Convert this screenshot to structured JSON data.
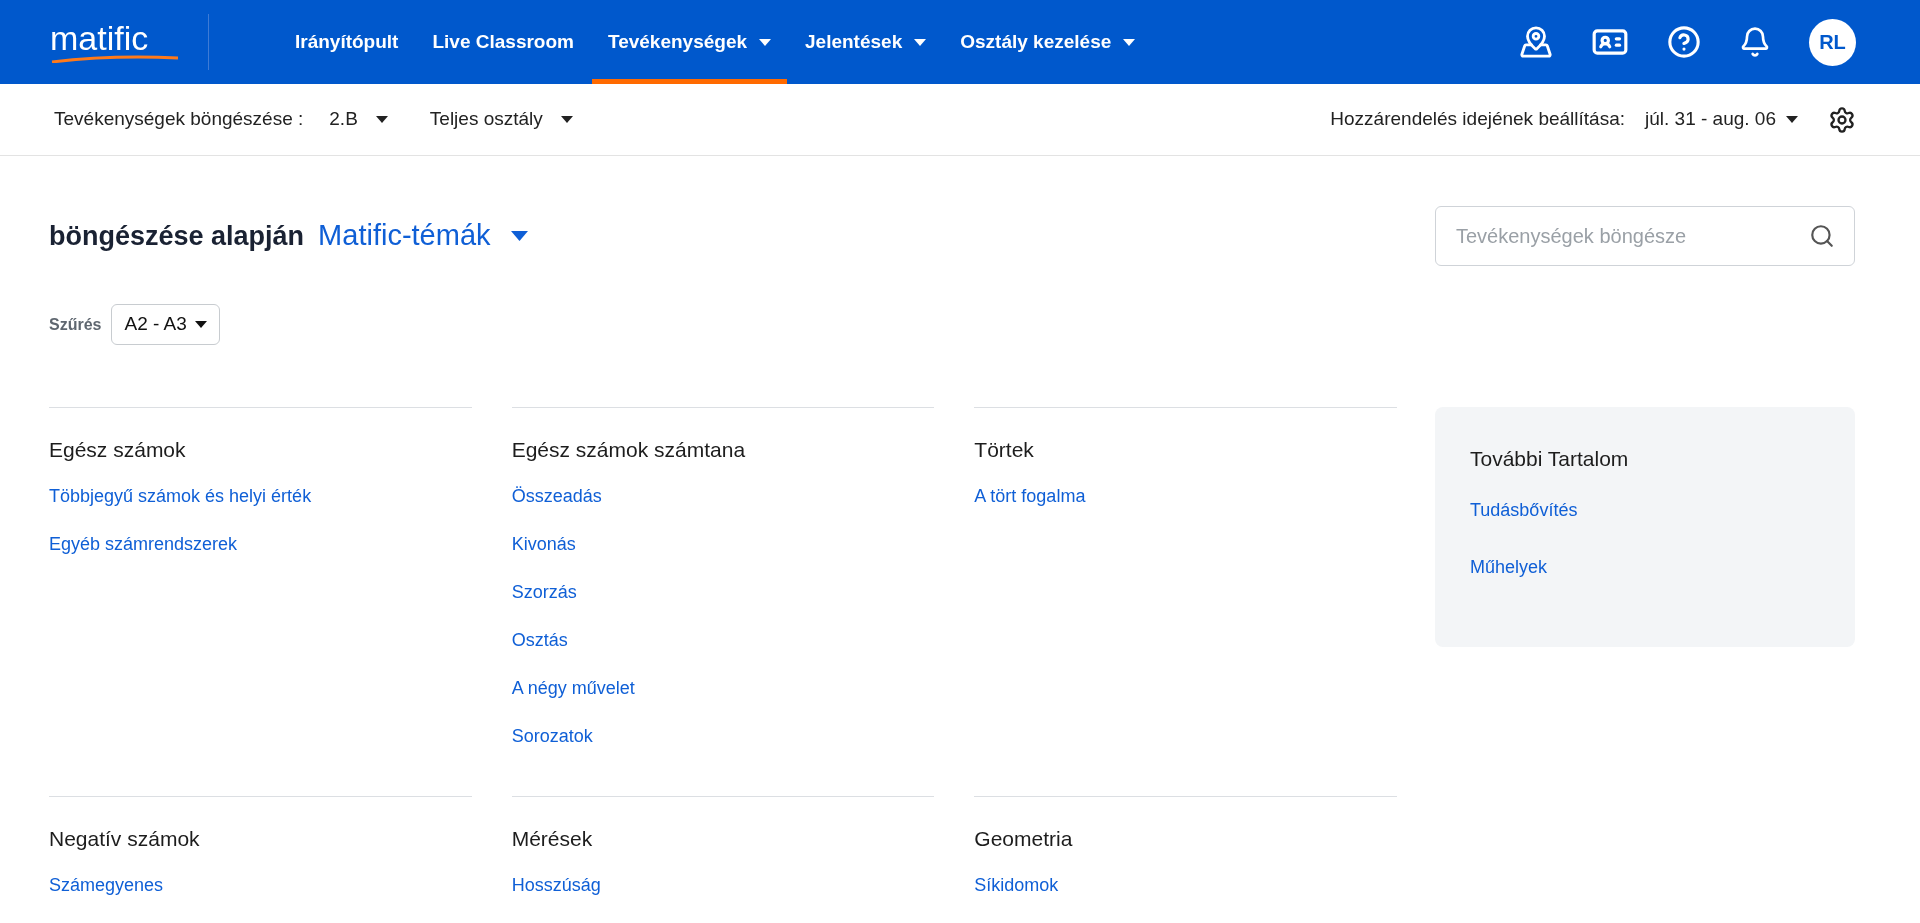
{
  "nav": {
    "logo": "matific",
    "items": [
      {
        "label": "Irányítópult",
        "selected": false,
        "dropdown": false
      },
      {
        "label": "Live Classroom",
        "selected": false,
        "dropdown": false
      },
      {
        "label": "Tevékenységek",
        "selected": true,
        "dropdown": true
      },
      {
        "label": "Jelentések",
        "selected": false,
        "dropdown": true
      },
      {
        "label": "Osztály kezelése",
        "selected": false,
        "dropdown": true
      }
    ],
    "avatar": "RL"
  },
  "subbar": {
    "browse_label": "Tevékenységek böngészése :",
    "class": "2.B",
    "group": "Teljes osztály",
    "assign_label": "Hozzárendelés idejének beállítása:",
    "date_range": "júl. 31 - aug. 06"
  },
  "heading": {
    "title": "böngészése alapján",
    "topic": "Matific-témák"
  },
  "search": {
    "placeholder": "Tevékenységek böngésze"
  },
  "filter": {
    "label": "Szűrés",
    "value": "A2 - A3"
  },
  "sections": [
    {
      "title": "Egész számok",
      "links": [
        "Többjegyű számok és helyi érték",
        "Egyéb számrendszerek"
      ]
    },
    {
      "title": "Egész számok számtana",
      "links": [
        "Összeadás",
        "Kivonás",
        "Szorzás",
        "Osztás",
        "A négy művelet",
        "Sorozatok"
      ]
    },
    {
      "title": "Törtek",
      "links": [
        "A tört fogalma"
      ]
    },
    {
      "title": "Negatív számok",
      "links": [
        "Számegyenes"
      ]
    },
    {
      "title": "Mérések",
      "links": [
        "Hosszúság"
      ]
    },
    {
      "title": "Geometria",
      "links": [
        "Síkidomok"
      ]
    }
  ],
  "more": {
    "title": "További Tartalom",
    "links": [
      "Tudásbővítés",
      "Műhelyek"
    ]
  }
}
